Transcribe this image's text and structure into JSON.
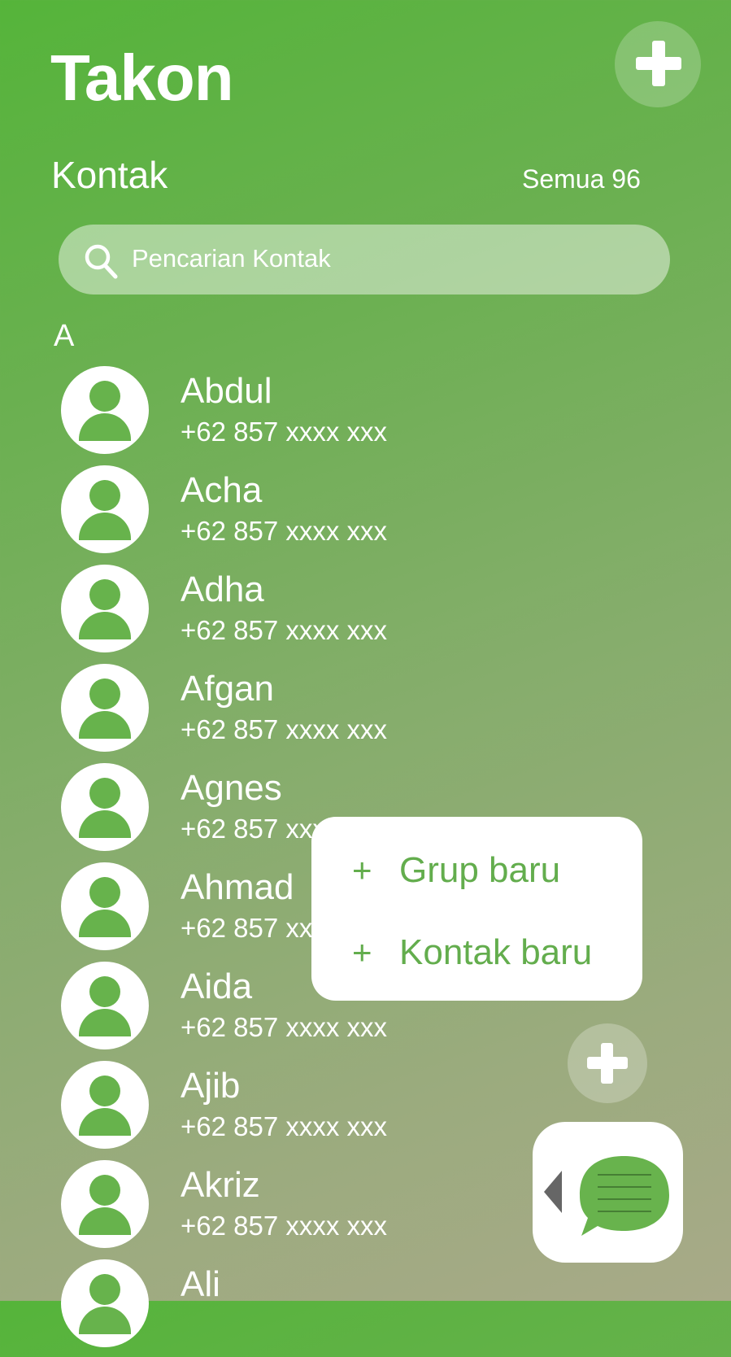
{
  "header": {
    "title": "Takon",
    "add_icon": "plus-icon"
  },
  "section": {
    "title": "Kontak",
    "count_label": "Semua 96"
  },
  "search": {
    "placeholder": "Pencarian Kontak",
    "icon": "search-icon"
  },
  "group_letter": "A",
  "contacts": [
    {
      "name": "Abdul",
      "phone": "+62 857 xxxx xxx"
    },
    {
      "name": "Acha",
      "phone": "+62 857 xxxx xxx"
    },
    {
      "name": "Adha",
      "phone": "+62 857 xxxx xxx"
    },
    {
      "name": "Afgan",
      "phone": "+62 857 xxxx xxx"
    },
    {
      "name": "Agnes",
      "phone": "+62 857 xxxx xxx"
    },
    {
      "name": "Ahmad",
      "phone": "+62 857 xxxx xxx"
    },
    {
      "name": "Aida",
      "phone": "+62 857 xxxx xxx"
    },
    {
      "name": "Ajib",
      "phone": "+62 857 xxxx xxx"
    },
    {
      "name": "Akriz",
      "phone": "+62 857 xxxx xxx"
    },
    {
      "name": "Ali",
      "phone": ""
    }
  ],
  "popup_menu": [
    {
      "icon": "+",
      "label": "Grup baru"
    },
    {
      "icon": "+",
      "label": "Kontak baru"
    }
  ],
  "fab": {
    "add_icon": "plus-icon",
    "chat_icon": "chat-bubble-icon",
    "collapse_icon": "arrow-left-icon"
  },
  "colors": {
    "accent": "#63ad4d",
    "background_top": "#55b43a",
    "background_bottom": "#a8aa88",
    "surface": "#ffffff"
  }
}
